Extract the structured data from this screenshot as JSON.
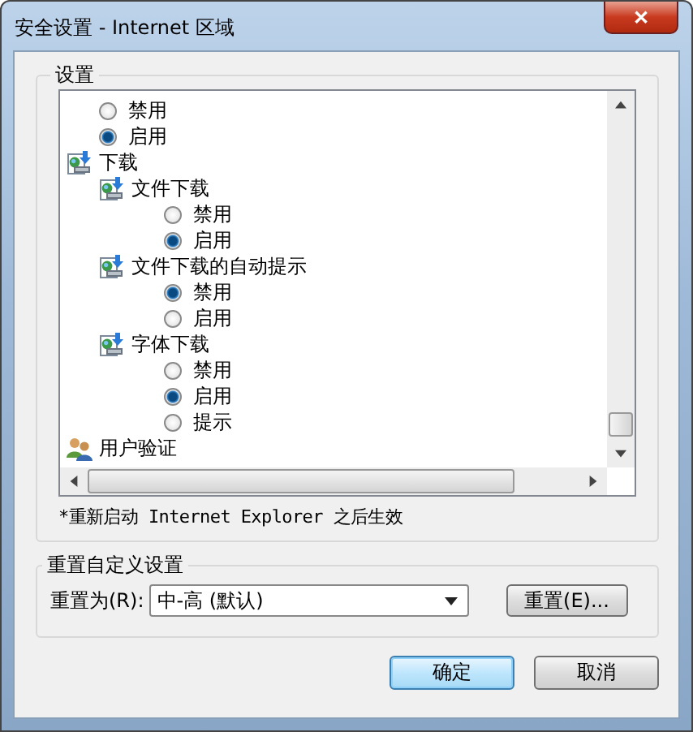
{
  "window": {
    "title": "安全设置 - Internet 区域",
    "close": "✕"
  },
  "settings": {
    "legend": "设置",
    "items": [
      {
        "kind": "radio",
        "label": "禁用",
        "selected": false
      },
      {
        "kind": "radio",
        "label": "启用",
        "selected": true
      },
      {
        "kind": "setting",
        "label": "下载",
        "children": [
          {
            "kind": "setting",
            "label": "文件下载",
            "children": [
              {
                "kind": "radio",
                "label": "禁用",
                "selected": false
              },
              {
                "kind": "radio",
                "label": "启用",
                "selected": true
              }
            ]
          },
          {
            "kind": "setting",
            "label": "文件下载的自动提示",
            "children": [
              {
                "kind": "radio",
                "label": "禁用",
                "selected": true
              },
              {
                "kind": "radio",
                "label": "启用",
                "selected": false
              }
            ]
          },
          {
            "kind": "setting",
            "label": "字体下载",
            "children": [
              {
                "kind": "radio",
                "label": "禁用",
                "selected": false
              },
              {
                "kind": "radio",
                "label": "启用",
                "selected": true
              },
              {
                "kind": "radio",
                "label": "提示",
                "selected": false
              }
            ]
          }
        ]
      },
      {
        "kind": "users",
        "label": "用户验证"
      }
    ],
    "note": "*重新启动 Internet Explorer 之后生效"
  },
  "reset": {
    "legend": "重置自定义设置",
    "label": "重置为(R):",
    "value": "中-高 (默认)",
    "button": "重置(E)..."
  },
  "buttons": [
    {
      "label": "确定",
      "default": true
    },
    {
      "label": "取消",
      "default": false
    }
  ]
}
